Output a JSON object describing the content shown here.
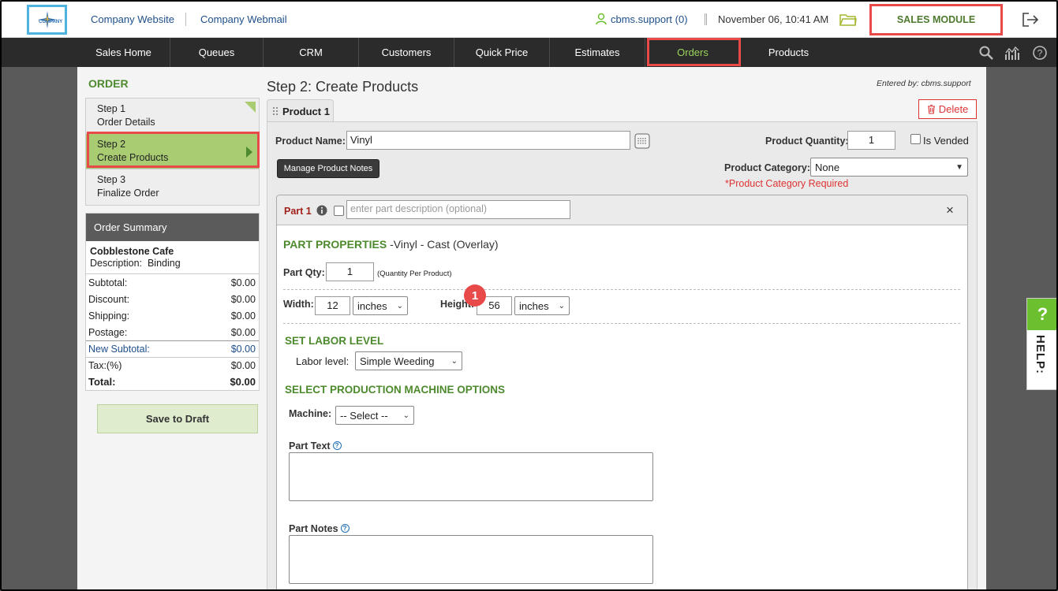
{
  "header": {
    "logo_text": "COMPANY",
    "links": [
      "Company Website",
      "Company Webmail"
    ],
    "user": "cbms.support (0)",
    "datetime": "November 06, 10:41 AM",
    "module": "SALES MODULE"
  },
  "nav": {
    "items": [
      "Sales Home",
      "Queues",
      "CRM",
      "Customers",
      "Quick Price",
      "Estimates",
      "Orders",
      "Products"
    ],
    "active": "Orders"
  },
  "sidebar": {
    "title": "ORDER",
    "steps": [
      {
        "num": "Step 1",
        "name": "Order Details"
      },
      {
        "num": "Step 2",
        "name": "Create Products"
      },
      {
        "num": "Step 3",
        "name": "Finalize Order"
      }
    ],
    "summary": {
      "heading": "Order Summary",
      "customer": "Cobblestone Cafe",
      "description_label": "Description:",
      "description": "Binding",
      "rows": [
        {
          "label": "Subtotal:",
          "value": "$0.00"
        },
        {
          "label": "Discount:",
          "value": "$0.00"
        },
        {
          "label": "Shipping:",
          "value": "$0.00"
        },
        {
          "label": "Postage:",
          "value": "$0.00"
        },
        {
          "label": "New Subtotal:",
          "value": "$0.00"
        },
        {
          "label": "Tax:(%)",
          "value": "$0.00"
        },
        {
          "label": "Total:",
          "value": "$0.00"
        }
      ]
    },
    "save_draft": "Save to Draft"
  },
  "main": {
    "title": "Step 2: Create Products",
    "entered_by": "Entered by: cbms.support",
    "tab": "Product 1",
    "delete": "Delete",
    "product": {
      "name_label": "Product Name:",
      "name_value": "Vinyl",
      "manage_notes": "Manage Product Notes",
      "qty_label": "Product Quantity:",
      "qty_value": "1",
      "is_vended": "Is Vended",
      "category_label": "Product Category:",
      "category_value": "None",
      "category_required": "*Product Category Required"
    },
    "part": {
      "label": "Part 1",
      "desc_placeholder": "enter part description (optional)",
      "close": "×",
      "properties_title": "PART PROPERTIES",
      "properties_sub": " -Vinyl - Cast (Overlay)",
      "qty_label": "Part Qty:",
      "qty_value": "1",
      "qty_note": "(Quantity Per Product)",
      "width_label": "Width:",
      "width_value": "12",
      "width_unit": "inches",
      "height_label": "Height:",
      "height_value": "56",
      "height_unit": "inches",
      "labor_title": "SET LABOR LEVEL",
      "labor_label": "Labor level:",
      "labor_value": "Simple Weeding",
      "badge": "1",
      "machine_title": "SELECT PRODUCTION MACHINE OPTIONS",
      "machine_label": "Machine:",
      "machine_value": "-- Select --",
      "part_text_label": "Part Text",
      "part_notes_label": "Part Notes"
    }
  },
  "help": {
    "q": "?",
    "label": "HELP:"
  },
  "colors": {
    "accent_green": "#4d8a2e",
    "highlight_red": "#e84a4a",
    "nav_bg": "#2b2b2b",
    "active_step": "#a9cc73"
  }
}
